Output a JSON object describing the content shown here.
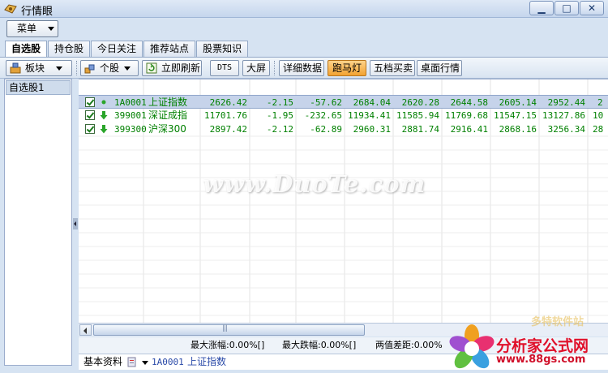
{
  "window": {
    "title": "行情眼",
    "buttons": {
      "minimize": "▁",
      "maximize": "□",
      "close": "✕"
    }
  },
  "menu": {
    "label": "菜单"
  },
  "tabs": [
    {
      "label": "自选股",
      "active": true
    },
    {
      "label": "持仓股",
      "active": false
    },
    {
      "label": "今日关注",
      "active": false
    },
    {
      "label": "推荐站点",
      "active": false
    },
    {
      "label": "股票知识",
      "active": false
    }
  ],
  "toolbar": {
    "sector_label": "板块",
    "stock_label": "个股",
    "refresh_label": "立即刷新",
    "dts_label": "DTS",
    "bigscreen_label": "大屏",
    "detail_label": "详细数据",
    "marquee_label": "跑马灯",
    "five_level_label": "五档买卖",
    "desktop_label": "桌面行情"
  },
  "left_panel": {
    "items": [
      "自选股1"
    ]
  },
  "grid": {
    "rows": [
      {
        "code": "1A0001",
        "name": "上证指数",
        "price": "2626.42",
        "change": "-2.15",
        "change_val": "-57.62",
        "v1": "2684.04",
        "v2": "2620.28",
        "v3": "2644.58",
        "v4": "2605.14",
        "v5": "2952.44",
        "v6": "2",
        "selected": true,
        "direction": "flat"
      },
      {
        "code": "399001",
        "name": "深证成指",
        "price": "11701.76",
        "change": "-1.95",
        "change_val": "-232.65",
        "v1": "11934.41",
        "v2": "11585.94",
        "v3": "11769.68",
        "v4": "11547.15",
        "v5": "13127.86",
        "v6": "10",
        "selected": false,
        "direction": "down"
      },
      {
        "code": "399300",
        "name": "沪深300",
        "price": "2897.42",
        "change": "-2.12",
        "change_val": "-62.89",
        "v1": "2960.31",
        "v2": "2881.74",
        "v3": "2916.41",
        "v4": "2868.16",
        "v5": "3256.34",
        "v6": "28",
        "selected": false,
        "direction": "down"
      }
    ]
  },
  "stats": {
    "max_rise": "最大涨幅:0.00%[]",
    "max_fall": "最大跌幅:0.00%[]",
    "spread": "两值差距:0.00%"
  },
  "status": {
    "label": "基本资料",
    "code": "1A0001",
    "name": "上证指数"
  },
  "watermarks": {
    "center": "www.DuoTe.com",
    "logo_title": "分析家公式网",
    "logo_url": "www.88gs.com",
    "corner": "多特软件站"
  },
  "colors": {
    "up_down_text": "#008000",
    "highlight_button": "#f2a232",
    "selected_row": "#c6d3ea"
  }
}
